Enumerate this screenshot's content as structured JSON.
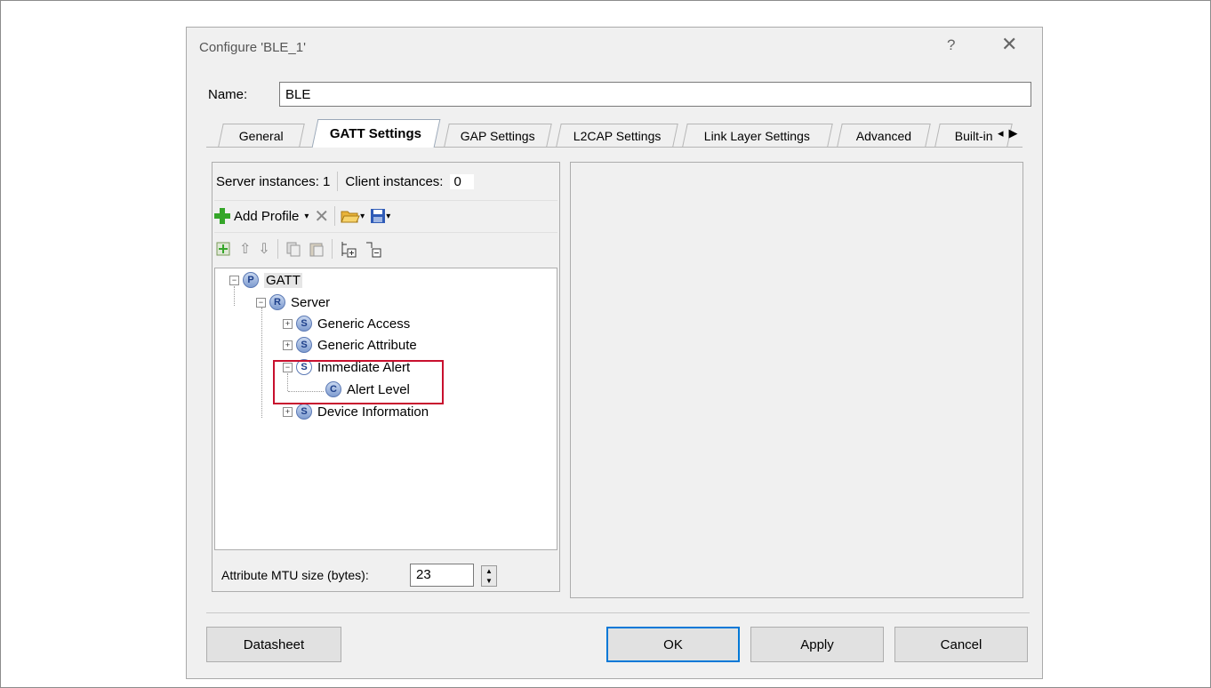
{
  "dialog": {
    "title": "Configure 'BLE_1'",
    "help_symbol": "?",
    "close_symbol": "✕"
  },
  "name": {
    "label": "Name:",
    "value": "BLE"
  },
  "tabs": [
    {
      "label": "General",
      "active": false
    },
    {
      "label": "GATT Settings",
      "active": true
    },
    {
      "label": "GAP Settings",
      "active": false
    },
    {
      "label": "L2CAP Settings",
      "active": false
    },
    {
      "label": "Link Layer Settings",
      "active": false
    },
    {
      "label": "Advanced",
      "active": false
    },
    {
      "label": "Built-in",
      "active": false
    }
  ],
  "tab_scroll": {
    "left": "◂",
    "right": "▶"
  },
  "gatt": {
    "server_instances_label": "Server instances: 1",
    "client_instances_label": "Client instances:",
    "client_instances_value": "0",
    "add_profile_label": "Add Profile",
    "tree": {
      "gatt": {
        "badge": "P",
        "label": "GATT"
      },
      "server": {
        "badge": "R",
        "label": "Server"
      },
      "generic_access": {
        "badge": "S",
        "label": "Generic Access"
      },
      "generic_attribute": {
        "badge": "S",
        "label": "Generic Attribute"
      },
      "immediate_alert": {
        "badge": "S",
        "label": "Immediate Alert"
      },
      "alert_level": {
        "badge": "C",
        "label": "Alert Level"
      },
      "device_information": {
        "badge": "S",
        "label": "Device Information"
      }
    },
    "mtu_label": "Attribute MTU size (bytes):",
    "mtu_value": "23"
  },
  "buttons": {
    "datasheet": "Datasheet",
    "ok": "OK",
    "apply": "Apply",
    "cancel": "Cancel"
  },
  "colors": {
    "highlight": "#c8102e",
    "default_button_border": "#0078d7",
    "add_icon": "#35a629"
  }
}
